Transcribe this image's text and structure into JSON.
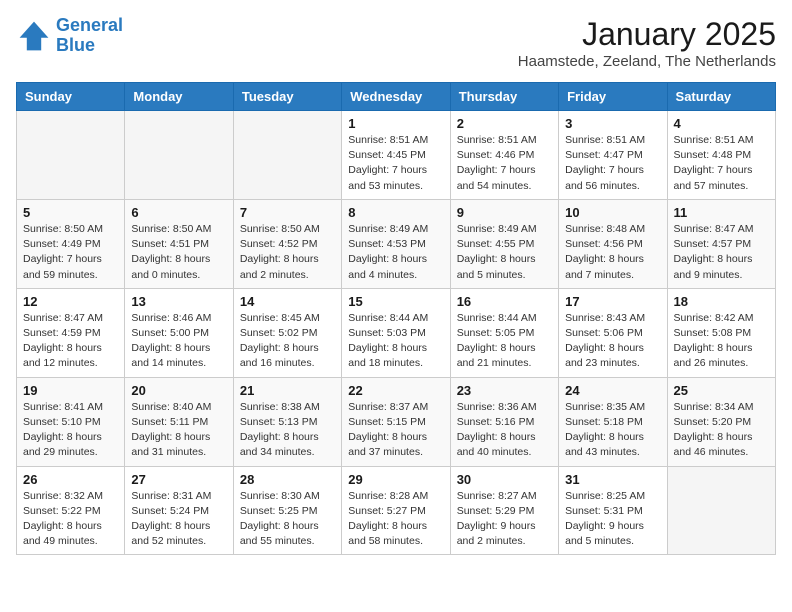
{
  "header": {
    "logo_line1": "General",
    "logo_line2": "Blue",
    "month_year": "January 2025",
    "location": "Haamstede, Zeeland, The Netherlands"
  },
  "weekdays": [
    "Sunday",
    "Monday",
    "Tuesday",
    "Wednesday",
    "Thursday",
    "Friday",
    "Saturday"
  ],
  "weeks": [
    [
      {
        "day": "",
        "info": ""
      },
      {
        "day": "",
        "info": ""
      },
      {
        "day": "",
        "info": ""
      },
      {
        "day": "1",
        "info": "Sunrise: 8:51 AM\nSunset: 4:45 PM\nDaylight: 7 hours\nand 53 minutes."
      },
      {
        "day": "2",
        "info": "Sunrise: 8:51 AM\nSunset: 4:46 PM\nDaylight: 7 hours\nand 54 minutes."
      },
      {
        "day": "3",
        "info": "Sunrise: 8:51 AM\nSunset: 4:47 PM\nDaylight: 7 hours\nand 56 minutes."
      },
      {
        "day": "4",
        "info": "Sunrise: 8:51 AM\nSunset: 4:48 PM\nDaylight: 7 hours\nand 57 minutes."
      }
    ],
    [
      {
        "day": "5",
        "info": "Sunrise: 8:50 AM\nSunset: 4:49 PM\nDaylight: 7 hours\nand 59 minutes."
      },
      {
        "day": "6",
        "info": "Sunrise: 8:50 AM\nSunset: 4:51 PM\nDaylight: 8 hours\nand 0 minutes."
      },
      {
        "day": "7",
        "info": "Sunrise: 8:50 AM\nSunset: 4:52 PM\nDaylight: 8 hours\nand 2 minutes."
      },
      {
        "day": "8",
        "info": "Sunrise: 8:49 AM\nSunset: 4:53 PM\nDaylight: 8 hours\nand 4 minutes."
      },
      {
        "day": "9",
        "info": "Sunrise: 8:49 AM\nSunset: 4:55 PM\nDaylight: 8 hours\nand 5 minutes."
      },
      {
        "day": "10",
        "info": "Sunrise: 8:48 AM\nSunset: 4:56 PM\nDaylight: 8 hours\nand 7 minutes."
      },
      {
        "day": "11",
        "info": "Sunrise: 8:47 AM\nSunset: 4:57 PM\nDaylight: 8 hours\nand 9 minutes."
      }
    ],
    [
      {
        "day": "12",
        "info": "Sunrise: 8:47 AM\nSunset: 4:59 PM\nDaylight: 8 hours\nand 12 minutes."
      },
      {
        "day": "13",
        "info": "Sunrise: 8:46 AM\nSunset: 5:00 PM\nDaylight: 8 hours\nand 14 minutes."
      },
      {
        "day": "14",
        "info": "Sunrise: 8:45 AM\nSunset: 5:02 PM\nDaylight: 8 hours\nand 16 minutes."
      },
      {
        "day": "15",
        "info": "Sunrise: 8:44 AM\nSunset: 5:03 PM\nDaylight: 8 hours\nand 18 minutes."
      },
      {
        "day": "16",
        "info": "Sunrise: 8:44 AM\nSunset: 5:05 PM\nDaylight: 8 hours\nand 21 minutes."
      },
      {
        "day": "17",
        "info": "Sunrise: 8:43 AM\nSunset: 5:06 PM\nDaylight: 8 hours\nand 23 minutes."
      },
      {
        "day": "18",
        "info": "Sunrise: 8:42 AM\nSunset: 5:08 PM\nDaylight: 8 hours\nand 26 minutes."
      }
    ],
    [
      {
        "day": "19",
        "info": "Sunrise: 8:41 AM\nSunset: 5:10 PM\nDaylight: 8 hours\nand 29 minutes."
      },
      {
        "day": "20",
        "info": "Sunrise: 8:40 AM\nSunset: 5:11 PM\nDaylight: 8 hours\nand 31 minutes."
      },
      {
        "day": "21",
        "info": "Sunrise: 8:38 AM\nSunset: 5:13 PM\nDaylight: 8 hours\nand 34 minutes."
      },
      {
        "day": "22",
        "info": "Sunrise: 8:37 AM\nSunset: 5:15 PM\nDaylight: 8 hours\nand 37 minutes."
      },
      {
        "day": "23",
        "info": "Sunrise: 8:36 AM\nSunset: 5:16 PM\nDaylight: 8 hours\nand 40 minutes."
      },
      {
        "day": "24",
        "info": "Sunrise: 8:35 AM\nSunset: 5:18 PM\nDaylight: 8 hours\nand 43 minutes."
      },
      {
        "day": "25",
        "info": "Sunrise: 8:34 AM\nSunset: 5:20 PM\nDaylight: 8 hours\nand 46 minutes."
      }
    ],
    [
      {
        "day": "26",
        "info": "Sunrise: 8:32 AM\nSunset: 5:22 PM\nDaylight: 8 hours\nand 49 minutes."
      },
      {
        "day": "27",
        "info": "Sunrise: 8:31 AM\nSunset: 5:24 PM\nDaylight: 8 hours\nand 52 minutes."
      },
      {
        "day": "28",
        "info": "Sunrise: 8:30 AM\nSunset: 5:25 PM\nDaylight: 8 hours\nand 55 minutes."
      },
      {
        "day": "29",
        "info": "Sunrise: 8:28 AM\nSunset: 5:27 PM\nDaylight: 8 hours\nand 58 minutes."
      },
      {
        "day": "30",
        "info": "Sunrise: 8:27 AM\nSunset: 5:29 PM\nDaylight: 9 hours\nand 2 minutes."
      },
      {
        "day": "31",
        "info": "Sunrise: 8:25 AM\nSunset: 5:31 PM\nDaylight: 9 hours\nand 5 minutes."
      },
      {
        "day": "",
        "info": ""
      }
    ]
  ]
}
